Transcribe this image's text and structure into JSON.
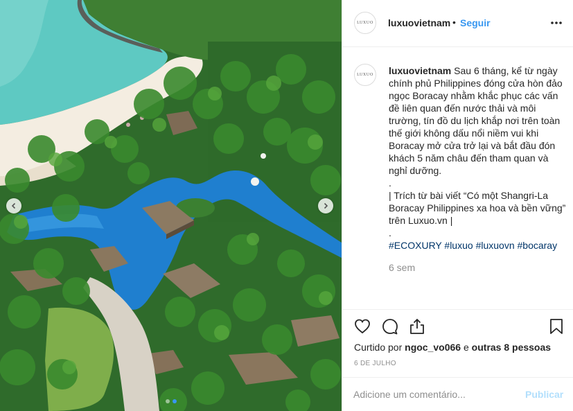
{
  "post": {
    "account": {
      "username": "luxuovietnam",
      "avatar_text": "LUXUO",
      "separator": "•",
      "follow_label": "Seguir"
    },
    "media": {
      "icons": {
        "prev": "chevron-left-icon",
        "next": "chevron-right-icon",
        "more": "ellipsis-icon"
      },
      "carousel_dots": 2,
      "active_dot": 1
    },
    "caption": {
      "username": "luxuovietnam",
      "text": "Sau 6 tháng, kể từ ngày chính phủ Philippines đóng cửa hòn đảo ngọc Boracay nhằm khắc phục các vấn đề liên quan đến nước thải và môi trường, tín đồ du lịch khắp nơi trên toàn thế giới không dấu nổi niềm vui khi Boracay mở cửa trở lại và bắt đầu đón khách 5 năm châu đến tham quan và nghỉ dưỡng.",
      "dot1": ".",
      "quote": "| Trích từ bài viết “Có một Shangri-La Boracay Philippines xa hoa và bền vững” trên Luxuo.vn |",
      "dot2": ".",
      "hashtags": [
        "#ECOXURY",
        "#luxuo",
        "#luxuovn",
        "#bocaray"
      ]
    },
    "time_ago": "6 sem",
    "actions": {
      "like_icon": "heart-icon",
      "comment_icon": "comment-bubble-icon",
      "share_icon": "share-icon",
      "save_icon": "bookmark-icon"
    },
    "likes": {
      "prefix": "Curtido por",
      "user": "ngoc_vo066",
      "middle": "e",
      "others": "outras 8 pessoas"
    },
    "date": "6 DE JULHO",
    "comment_box": {
      "placeholder": "Adicione um comentário...",
      "publish_label": "Publicar"
    },
    "colors": {
      "link_blue": "#3897f0",
      "hashtag": "#003569",
      "muted": "#8e8e8e",
      "publish_disabled": "#b2dffc",
      "border": "#efefef"
    }
  }
}
